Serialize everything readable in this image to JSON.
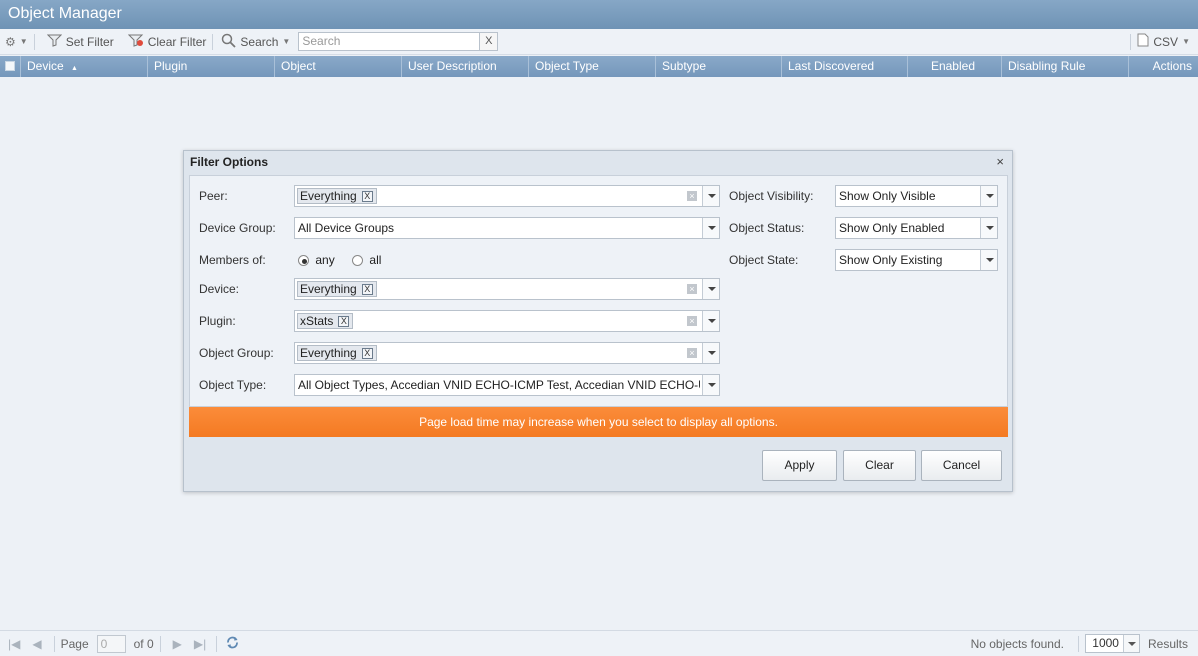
{
  "app": {
    "title": "Object Manager"
  },
  "toolbar": {
    "set_filter": "Set Filter",
    "clear_filter": "Clear Filter",
    "search_menu": "Search",
    "search_placeholder": "Search",
    "search_clear": "X",
    "csv": "CSV"
  },
  "grid": {
    "columns": [
      "Device",
      "Plugin",
      "Object",
      "User Description",
      "Object Type",
      "Subtype",
      "Last Discovered",
      "Enabled",
      "Disabling Rule",
      "Actions"
    ],
    "sort_indicator": "▲"
  },
  "dialog": {
    "title": "Filter Options",
    "close": "×",
    "fields": {
      "peer": {
        "label": "Peer:",
        "tag": "Everything"
      },
      "device_group": {
        "label": "Device Group:",
        "value": "All Device Groups"
      },
      "members_of": {
        "label": "Members of:",
        "any": "any",
        "all": "all",
        "selected": "any"
      },
      "device": {
        "label": "Device:",
        "tag": "Everything"
      },
      "plugin": {
        "label": "Plugin:",
        "tag": "xStats"
      },
      "object_group": {
        "label": "Object Group:",
        "tag": "Everything"
      },
      "object_type": {
        "label": "Object Type:",
        "value": "All Object Types, Accedian VNID ECHO-ICMP Test, Accedian VNID ECHO-UD"
      },
      "object_visibility": {
        "label": "Object Visibility:",
        "value": "Show Only Visible"
      },
      "object_status": {
        "label": "Object Status:",
        "value": "Show Only Enabled"
      },
      "object_state": {
        "label": "Object State:",
        "value": "Show Only Existing"
      }
    },
    "tag_remove": "X",
    "banner": "Page load time may increase when you select to display all options.",
    "buttons": {
      "apply": "Apply",
      "clear": "Clear",
      "cancel": "Cancel"
    }
  },
  "footer": {
    "page_label": "Page",
    "page_value": "0",
    "of_label": "of 0",
    "status": "No objects found.",
    "per_page": "1000",
    "results_label": "Results"
  },
  "colors": {
    "banner": "#f47a22",
    "header": "#7597bb",
    "titlebar": "#7c9ebf"
  }
}
